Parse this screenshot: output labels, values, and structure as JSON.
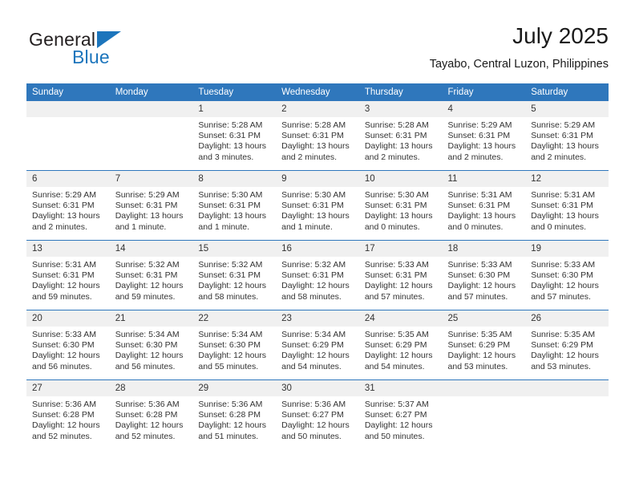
{
  "logo": {
    "word_one": "General",
    "word_two": "Blue",
    "triangle_icon": "triangle-icon",
    "brand_color": "#1c75bc"
  },
  "header": {
    "title": "July 2025",
    "location": "Tayabo, Central Luzon, Philippines"
  },
  "theme": {
    "header_blue": "#2f77bc",
    "daynum_band": "#f0f0f0",
    "text": "#333333"
  },
  "calendar": {
    "weekday_headers": [
      "Sunday",
      "Monday",
      "Tuesday",
      "Wednesday",
      "Thursday",
      "Friday",
      "Saturday"
    ],
    "weeks": [
      [
        {
          "day": "",
          "sunrise": "",
          "sunset": "",
          "daylight": "",
          "daylight2": ""
        },
        {
          "day": "",
          "sunrise": "",
          "sunset": "",
          "daylight": "",
          "daylight2": ""
        },
        {
          "day": "1",
          "sunrise": "Sunrise: 5:28 AM",
          "sunset": "Sunset: 6:31 PM",
          "daylight": "Daylight: 13 hours",
          "daylight2": "and 3 minutes."
        },
        {
          "day": "2",
          "sunrise": "Sunrise: 5:28 AM",
          "sunset": "Sunset: 6:31 PM",
          "daylight": "Daylight: 13 hours",
          "daylight2": "and 2 minutes."
        },
        {
          "day": "3",
          "sunrise": "Sunrise: 5:28 AM",
          "sunset": "Sunset: 6:31 PM",
          "daylight": "Daylight: 13 hours",
          "daylight2": "and 2 minutes."
        },
        {
          "day": "4",
          "sunrise": "Sunrise: 5:29 AM",
          "sunset": "Sunset: 6:31 PM",
          "daylight": "Daylight: 13 hours",
          "daylight2": "and 2 minutes."
        },
        {
          "day": "5",
          "sunrise": "Sunrise: 5:29 AM",
          "sunset": "Sunset: 6:31 PM",
          "daylight": "Daylight: 13 hours",
          "daylight2": "and 2 minutes."
        }
      ],
      [
        {
          "day": "6",
          "sunrise": "Sunrise: 5:29 AM",
          "sunset": "Sunset: 6:31 PM",
          "daylight": "Daylight: 13 hours",
          "daylight2": "and 2 minutes."
        },
        {
          "day": "7",
          "sunrise": "Sunrise: 5:29 AM",
          "sunset": "Sunset: 6:31 PM",
          "daylight": "Daylight: 13 hours",
          "daylight2": "and 1 minute."
        },
        {
          "day": "8",
          "sunrise": "Sunrise: 5:30 AM",
          "sunset": "Sunset: 6:31 PM",
          "daylight": "Daylight: 13 hours",
          "daylight2": "and 1 minute."
        },
        {
          "day": "9",
          "sunrise": "Sunrise: 5:30 AM",
          "sunset": "Sunset: 6:31 PM",
          "daylight": "Daylight: 13 hours",
          "daylight2": "and 1 minute."
        },
        {
          "day": "10",
          "sunrise": "Sunrise: 5:30 AM",
          "sunset": "Sunset: 6:31 PM",
          "daylight": "Daylight: 13 hours",
          "daylight2": "and 0 minutes."
        },
        {
          "day": "11",
          "sunrise": "Sunrise: 5:31 AM",
          "sunset": "Sunset: 6:31 PM",
          "daylight": "Daylight: 13 hours",
          "daylight2": "and 0 minutes."
        },
        {
          "day": "12",
          "sunrise": "Sunrise: 5:31 AM",
          "sunset": "Sunset: 6:31 PM",
          "daylight": "Daylight: 13 hours",
          "daylight2": "and 0 minutes."
        }
      ],
      [
        {
          "day": "13",
          "sunrise": "Sunrise: 5:31 AM",
          "sunset": "Sunset: 6:31 PM",
          "daylight": "Daylight: 12 hours",
          "daylight2": "and 59 minutes."
        },
        {
          "day": "14",
          "sunrise": "Sunrise: 5:32 AM",
          "sunset": "Sunset: 6:31 PM",
          "daylight": "Daylight: 12 hours",
          "daylight2": "and 59 minutes."
        },
        {
          "day": "15",
          "sunrise": "Sunrise: 5:32 AM",
          "sunset": "Sunset: 6:31 PM",
          "daylight": "Daylight: 12 hours",
          "daylight2": "and 58 minutes."
        },
        {
          "day": "16",
          "sunrise": "Sunrise: 5:32 AM",
          "sunset": "Sunset: 6:31 PM",
          "daylight": "Daylight: 12 hours",
          "daylight2": "and 58 minutes."
        },
        {
          "day": "17",
          "sunrise": "Sunrise: 5:33 AM",
          "sunset": "Sunset: 6:31 PM",
          "daylight": "Daylight: 12 hours",
          "daylight2": "and 57 minutes."
        },
        {
          "day": "18",
          "sunrise": "Sunrise: 5:33 AM",
          "sunset": "Sunset: 6:30 PM",
          "daylight": "Daylight: 12 hours",
          "daylight2": "and 57 minutes."
        },
        {
          "day": "19",
          "sunrise": "Sunrise: 5:33 AM",
          "sunset": "Sunset: 6:30 PM",
          "daylight": "Daylight: 12 hours",
          "daylight2": "and 57 minutes."
        }
      ],
      [
        {
          "day": "20",
          "sunrise": "Sunrise: 5:33 AM",
          "sunset": "Sunset: 6:30 PM",
          "daylight": "Daylight: 12 hours",
          "daylight2": "and 56 minutes."
        },
        {
          "day": "21",
          "sunrise": "Sunrise: 5:34 AM",
          "sunset": "Sunset: 6:30 PM",
          "daylight": "Daylight: 12 hours",
          "daylight2": "and 56 minutes."
        },
        {
          "day": "22",
          "sunrise": "Sunrise: 5:34 AM",
          "sunset": "Sunset: 6:30 PM",
          "daylight": "Daylight: 12 hours",
          "daylight2": "and 55 minutes."
        },
        {
          "day": "23",
          "sunrise": "Sunrise: 5:34 AM",
          "sunset": "Sunset: 6:29 PM",
          "daylight": "Daylight: 12 hours",
          "daylight2": "and 54 minutes."
        },
        {
          "day": "24",
          "sunrise": "Sunrise: 5:35 AM",
          "sunset": "Sunset: 6:29 PM",
          "daylight": "Daylight: 12 hours",
          "daylight2": "and 54 minutes."
        },
        {
          "day": "25",
          "sunrise": "Sunrise: 5:35 AM",
          "sunset": "Sunset: 6:29 PM",
          "daylight": "Daylight: 12 hours",
          "daylight2": "and 53 minutes."
        },
        {
          "day": "26",
          "sunrise": "Sunrise: 5:35 AM",
          "sunset": "Sunset: 6:29 PM",
          "daylight": "Daylight: 12 hours",
          "daylight2": "and 53 minutes."
        }
      ],
      [
        {
          "day": "27",
          "sunrise": "Sunrise: 5:36 AM",
          "sunset": "Sunset: 6:28 PM",
          "daylight": "Daylight: 12 hours",
          "daylight2": "and 52 minutes."
        },
        {
          "day": "28",
          "sunrise": "Sunrise: 5:36 AM",
          "sunset": "Sunset: 6:28 PM",
          "daylight": "Daylight: 12 hours",
          "daylight2": "and 52 minutes."
        },
        {
          "day": "29",
          "sunrise": "Sunrise: 5:36 AM",
          "sunset": "Sunset: 6:28 PM",
          "daylight": "Daylight: 12 hours",
          "daylight2": "and 51 minutes."
        },
        {
          "day": "30",
          "sunrise": "Sunrise: 5:36 AM",
          "sunset": "Sunset: 6:27 PM",
          "daylight": "Daylight: 12 hours",
          "daylight2": "and 50 minutes."
        },
        {
          "day": "31",
          "sunrise": "Sunrise: 5:37 AM",
          "sunset": "Sunset: 6:27 PM",
          "daylight": "Daylight: 12 hours",
          "daylight2": "and 50 minutes."
        },
        {
          "day": "",
          "sunrise": "",
          "sunset": "",
          "daylight": "",
          "daylight2": ""
        },
        {
          "day": "",
          "sunrise": "",
          "sunset": "",
          "daylight": "",
          "daylight2": ""
        }
      ]
    ]
  }
}
